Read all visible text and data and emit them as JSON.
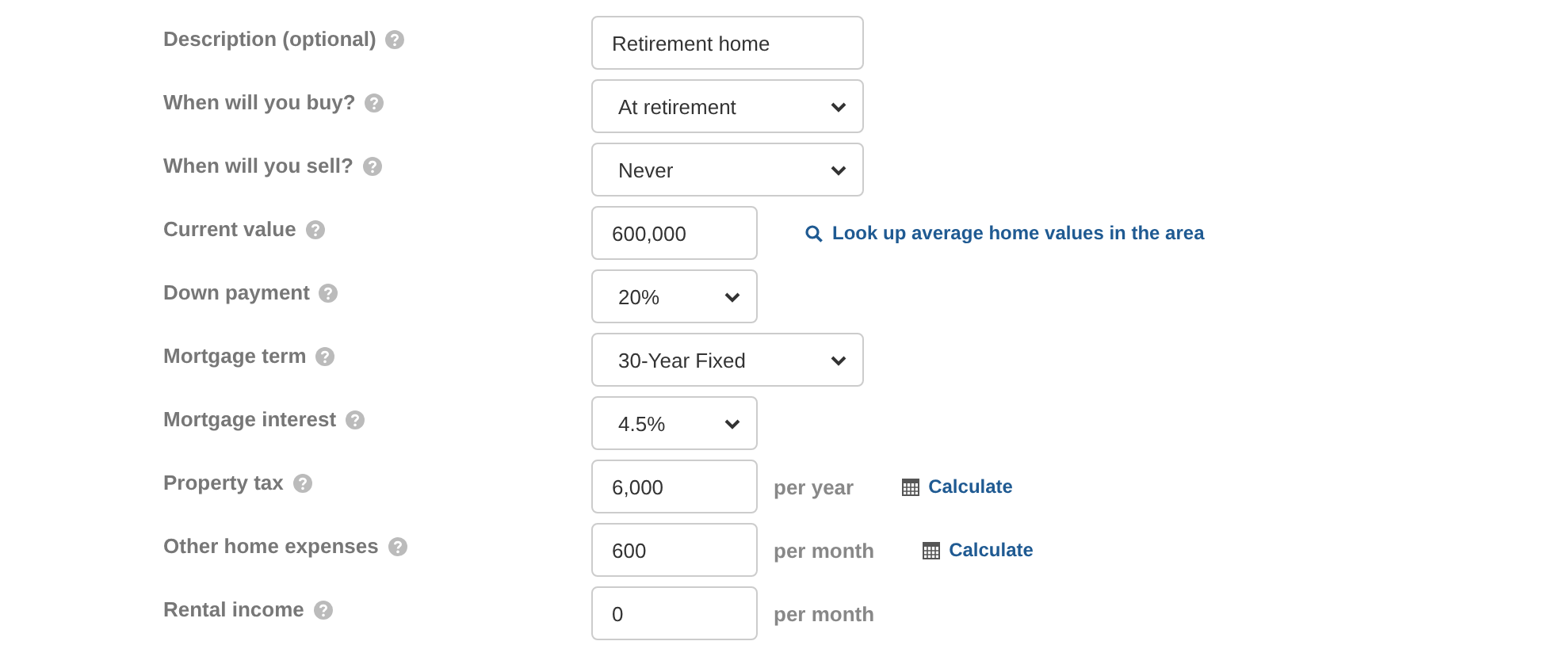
{
  "fields": [
    {
      "label": "Description (optional)",
      "kind": "text",
      "value": "Retirement home"
    },
    {
      "label": "When will you buy?",
      "kind": "select",
      "value": "At retirement"
    },
    {
      "label": "When will you sell?",
      "kind": "select",
      "value": "Never"
    },
    {
      "label": "Current value",
      "kind": "short-text",
      "value": "600,000",
      "link": {
        "kind": "search",
        "text": "Look up average home values in the area"
      }
    },
    {
      "label": "Down payment",
      "kind": "short-select",
      "value": "20%"
    },
    {
      "label": "Mortgage term",
      "kind": "select",
      "value": "30-Year Fixed"
    },
    {
      "label": "Mortgage interest",
      "kind": "short-select",
      "value": "4.5%"
    },
    {
      "label": "Property tax",
      "kind": "short-text",
      "value": "6,000",
      "unit": "per year",
      "link": {
        "kind": "calculator",
        "text": "Calculate"
      }
    },
    {
      "label": "Other home expenses",
      "kind": "short-text",
      "value": "600",
      "unit": "per month",
      "link": {
        "kind": "calculator",
        "text": "Calculate"
      }
    },
    {
      "label": "Rental income",
      "kind": "short-text",
      "value": "0",
      "unit": "per month"
    }
  ]
}
